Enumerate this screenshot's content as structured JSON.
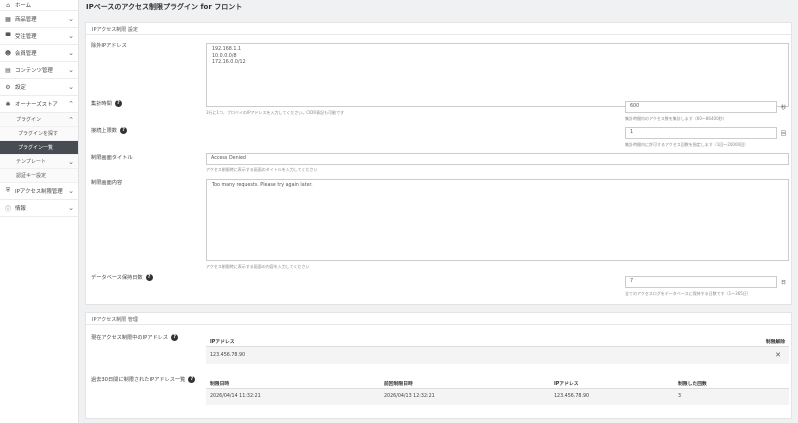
{
  "sidebar": {
    "home": "ホーム",
    "items": [
      {
        "label": "商品管理",
        "icon": "▦"
      },
      {
        "label": "受注管理",
        "icon": "🛒"
      },
      {
        "label": "会員管理",
        "icon": "👥"
      },
      {
        "label": "コンテンツ管理",
        "icon": "▤"
      },
      {
        "label": "設定",
        "icon": "⚙"
      },
      {
        "label": "オーナーズストア",
        "icon": "✱"
      }
    ],
    "plugin": "プラグイン",
    "plugin_search": "プラグインを探す",
    "plugin_list": "プラグイン一覧",
    "template": "テンプレート",
    "auth_key": "認証キー設定",
    "ip_access": "IPアクセス制限管理",
    "info": "情報"
  },
  "page_title": "IPベースのアクセス制限プラグイン for フロント",
  "settings": {
    "section_title": "IPアクセス制限 設定",
    "whitelist_label": "除外IPアドレス",
    "whitelist_values": [
      "192.168.1.1",
      "10.0.0.0/8",
      "172.16.0.0/12"
    ],
    "whitelist_hint": "1行に1つ、プロベイのIPアドレスを入力してください。CIDR表記も可能です",
    "period_label": "集計時間",
    "period_value": "600",
    "period_unit": "秒",
    "period_hint": "集計時間内のアクセス数を集計します（60〜86400秒）",
    "limit_label": "接続上限数",
    "limit_value": "1",
    "limit_unit": "回",
    "limit_hint": "集計時間内に許可するアクセス回数を指定します（1回〜20000回）",
    "title_label": "制限画面タイトル",
    "title_value": "Access Denied",
    "title_hint": "アクセス制限時に表示する画面のタイトルを入力してください",
    "content_label": "制限画面内容",
    "content_value": "Too many requests. Please try again later.",
    "content_hint": "アクセス制限時に表示する画面の内容を入力してください",
    "retention_label": "データベース保持日数",
    "retention_value": "7",
    "retention_unit": "日",
    "retention_hint": "全てのアクセスログをデータベースに保持する日数です（1〜365日）"
  },
  "management": {
    "section_title": "IPアクセス制限 管理",
    "blocked_label": "現在アクセス制限中のIPアドレス",
    "blocked_header_ip": "IPアドレス",
    "blocked_header_action": "制限解除",
    "blocked_rows": [
      {
        "ip": "123.456.78.90"
      }
    ],
    "history_label": "過去30日間に制限されたIPアドレス一覧",
    "history_headers": [
      "制限日時",
      "前回制限日時",
      "IPアドレス",
      "制限した回数"
    ],
    "history_rows": [
      {
        "date": "2026/04/14 11:32:21",
        "prev": "2026/04/13 12:32:21",
        "ip": "123.456.78.90",
        "count": "3"
      }
    ]
  }
}
